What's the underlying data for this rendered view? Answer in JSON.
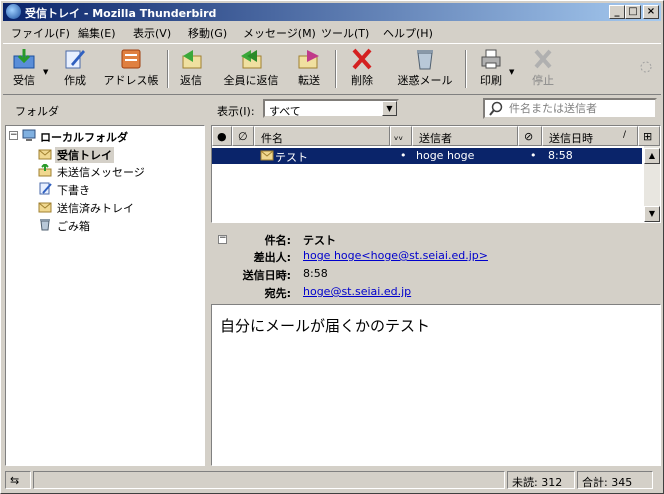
{
  "window": {
    "title": "受信トレイ - Mozilla Thunderbird",
    "buttons": {
      "minimize": "_",
      "maximize": "□",
      "close": "×"
    }
  },
  "menu": [
    "ファイル(F)",
    "編集(E)",
    "表示(V)",
    "移動(G)",
    "メッセージ(M)",
    "ツール(T)",
    "ヘルプ(H)"
  ],
  "toolbar": {
    "get_mail": "受信",
    "compose": "作成",
    "address_book": "アドレス帳",
    "reply": "返信",
    "reply_all": "全員に返信",
    "forward": "転送",
    "delete": "削除",
    "junk": "迷惑メール",
    "print": "印刷",
    "stop": "停止"
  },
  "folder_pane": {
    "header": "フォルダ",
    "root": "ローカルフォルダ",
    "folders": [
      "受信トレイ",
      "未送信メッセージ",
      "下書き",
      "送信済みトレイ",
      "ごみ箱"
    ],
    "selected": "受信トレイ"
  },
  "view": {
    "label": "表示(I):",
    "selected": "すべて",
    "search_placeholder": "件名または送信者"
  },
  "thread_columns": {
    "subject": "件名",
    "sender": "送信者",
    "date": "送信日時"
  },
  "messages": [
    {
      "subject": "テスト",
      "sender": "hoge hoge",
      "date": "8:58"
    }
  ],
  "message_header": {
    "subject_label": "件名:",
    "subject": "テスト",
    "from_label": "差出人:",
    "from": "hoge hoge<hoge@st.seiai.ed.jp>",
    "date_label": "送信日時:",
    "date": "8:58",
    "to_label": "宛先:",
    "to": "hoge@st.seiai.ed.jp"
  },
  "message_body": "自分にメールが届くかのテスト",
  "status": {
    "unread": "未読: 312",
    "total": "合計: 345"
  },
  "colors": {
    "selection": "#0a246a",
    "title_start": "#0a246a",
    "link": "#0000cc"
  }
}
